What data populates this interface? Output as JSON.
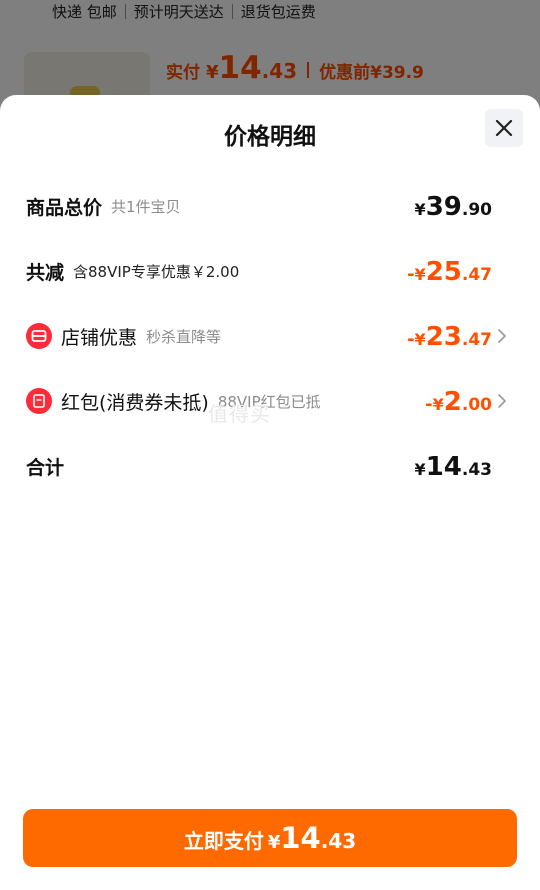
{
  "background": {
    "tags": [
      "快递 包邮",
      "预计明天送达",
      "退货包运费"
    ],
    "paid_label": "实付",
    "paid_yen": "¥",
    "paid_int": "14",
    "paid_dec": ".43",
    "before_label": "优惠前",
    "before_value": "¥39.9"
  },
  "sheet": {
    "title": "价格明细",
    "close_icon": "close-icon"
  },
  "rows": {
    "total": {
      "label": "商品总价",
      "sub": "共1件宝贝",
      "sign": "",
      "yen": "¥",
      "int": "39",
      "dec": ".90"
    },
    "reduction": {
      "label": "共减",
      "sub": "含88VIP专享优惠￥2.00",
      "sign": "-",
      "yen": "¥",
      "int": "25",
      "dec": ".47"
    },
    "store": {
      "label": "店铺优惠",
      "sub": "秒杀直降等",
      "sign": "-",
      "yen": "¥",
      "int": "23",
      "dec": ".47",
      "icon": "store-coupon-icon"
    },
    "redpacket": {
      "label": "红包(消费券未抵)",
      "sub": "88VIP红包已抵",
      "sign": "-",
      "yen": "¥",
      "int": "2",
      "dec": ".00",
      "icon": "red-packet-icon"
    },
    "sum": {
      "label": "合计",
      "sign": "",
      "yen": "¥",
      "int": "14",
      "dec": ".43"
    }
  },
  "watermark": "值得买",
  "pay_button": {
    "label": "立即支付",
    "yen": "¥",
    "int": "14",
    "dec": ".43"
  },
  "colors": {
    "accent": "#ff5000",
    "button": "#ff6a00",
    "icon_red": "#ff2a3a"
  }
}
